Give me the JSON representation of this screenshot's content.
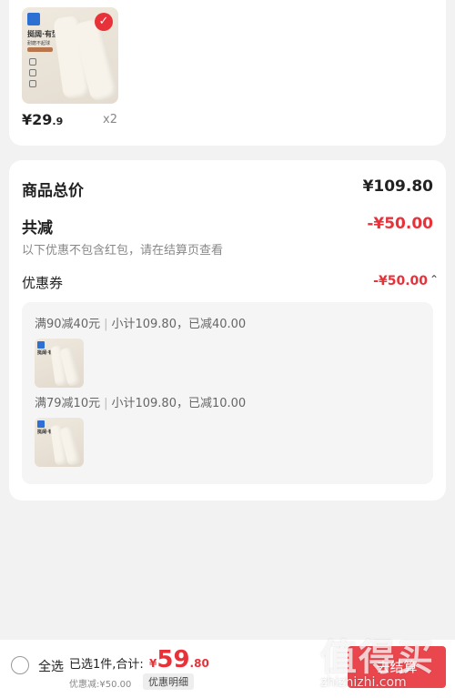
{
  "product": {
    "thumb_title": "挺阔·有型",
    "thumb_sub": "耐磨不起球",
    "price_int": "¥29",
    "price_dec": ".9",
    "qty": "x2"
  },
  "summary": {
    "total_label": "商品总价",
    "total_value": "¥109.80",
    "reduce_label": "共减",
    "reduce_value": "-¥50.00",
    "note": "以下优惠不包含红包，请在结算页查看",
    "coupon_label": "优惠券",
    "coupon_value": "-¥50.00",
    "coupon_caret": "⌃"
  },
  "discounts": [
    {
      "rule": "满90减40元",
      "sep": "|",
      "detail": "小计109.80，已减40.00",
      "thumb_title": "挺阔·有型"
    },
    {
      "rule": "满79减10元",
      "sep": "|",
      "detail": "小计109.80，已减10.00",
      "thumb_title": "挺阔·有型"
    }
  ],
  "footer": {
    "select_all": "全选",
    "selected": "已选1件,合计:",
    "currency": "¥",
    "sum_int": "59",
    "sum_dec": ".80",
    "discount_text": "优惠减:¥50.00",
    "discount_detail_btn": "优惠明细",
    "checkout": "去结算",
    "watermark": "值得买",
    "watermark_url": "zhizhizhi.com"
  },
  "colors": {
    "accent": "#e8323a",
    "brand": "#2d6fd3"
  }
}
